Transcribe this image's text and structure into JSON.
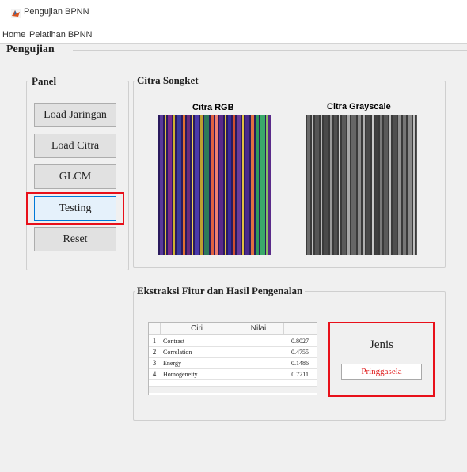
{
  "window": {
    "title": "Pengujian BPNN"
  },
  "menu": {
    "items": [
      "Home",
      "Pelatihan BPNN"
    ]
  },
  "main": {
    "title": "Pengujian"
  },
  "panel": {
    "title": "Panel",
    "buttons": [
      "Load Jaringan",
      "Load Citra",
      "GLCM",
      "Testing",
      "Reset"
    ]
  },
  "citra": {
    "title": "Citra Songket",
    "rgb_title": "Citra RGB",
    "gray_title": "Citra Grayscale"
  },
  "ekstraksi": {
    "title": "Ekstraksi Fitur dan Hasil Pengenalan",
    "table": {
      "headers": [
        "Ciri",
        "Nilai"
      ],
      "rows": [
        {
          "num": "1",
          "ciri": "Contrast",
          "nilai": "0.8027"
        },
        {
          "num": "2",
          "ciri": "Correlation",
          "nilai": "0.4755"
        },
        {
          "num": "3",
          "ciri": "Energy",
          "nilai": "0.1486"
        },
        {
          "num": "4",
          "ciri": "Homogeneity",
          "nilai": "0.7211"
        }
      ]
    },
    "jenis_label": "Jenis",
    "jenis_value": "Pringgasela"
  },
  "colors": {
    "highlight": "#e8101a",
    "result_text": "#e02020",
    "testing_focus": "#0078d7"
  }
}
